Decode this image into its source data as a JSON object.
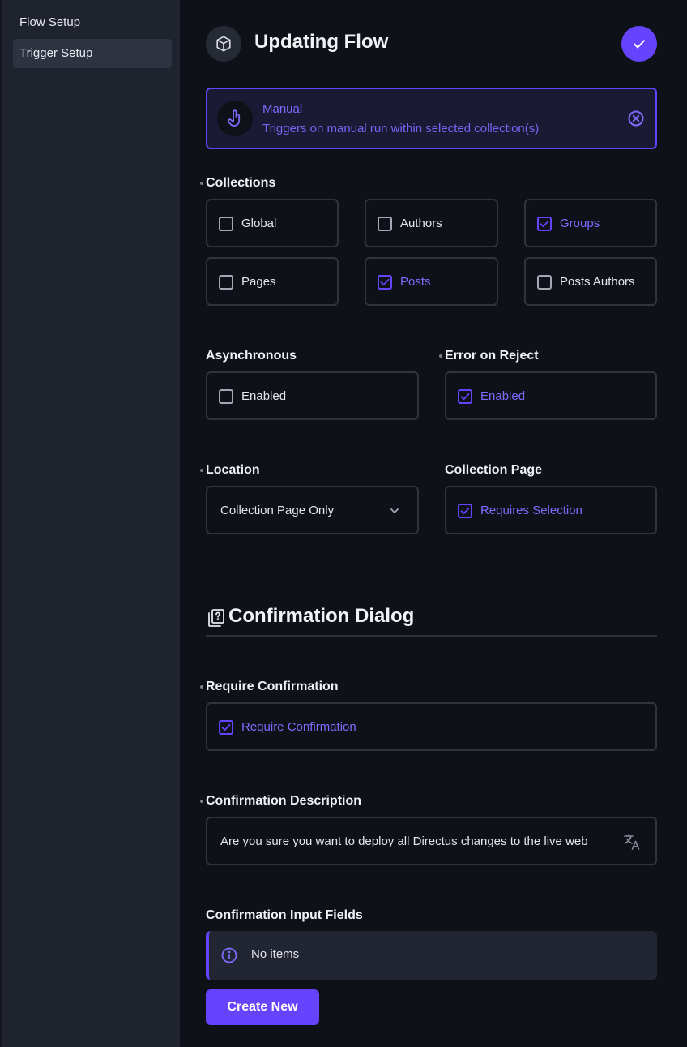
{
  "sidebar": {
    "items": [
      {
        "label": "Flow Setup"
      },
      {
        "label": "Trigger Setup"
      }
    ]
  },
  "header": {
    "title": "Updating Flow",
    "icon": "cube-icon",
    "save_icon": "check-icon"
  },
  "trigger": {
    "name": "Manual",
    "description": "Triggers on manual run within selected collection(s)",
    "icon": "touch-icon"
  },
  "collections": {
    "label": "Collections",
    "options": [
      {
        "label": "Global",
        "checked": false
      },
      {
        "label": "Authors",
        "checked": false
      },
      {
        "label": "Groups",
        "checked": true
      },
      {
        "label": "Pages",
        "checked": false
      },
      {
        "label": "Posts",
        "checked": true
      },
      {
        "label": "Posts Authors",
        "checked": false
      }
    ]
  },
  "asynchronous": {
    "label": "Asynchronous",
    "option": "Enabled",
    "checked": false
  },
  "error_on_reject": {
    "label": "Error on Reject",
    "option": "Enabled",
    "checked": true
  },
  "location": {
    "label": "Location",
    "value": "Collection Page Only"
  },
  "collection_page": {
    "label": "Collection Page",
    "option": "Requires Selection",
    "checked": true
  },
  "confirmation_section": {
    "title": "Confirmation Dialog"
  },
  "require_confirmation": {
    "label": "Require Confirmation",
    "option": "Require Confirmation",
    "checked": true
  },
  "confirmation_description": {
    "label": "Confirmation Description",
    "value": "Are you sure you want to deploy all Directus changes to the live web"
  },
  "confirmation_input_fields": {
    "label": "Confirmation Input Fields",
    "empty_text": "No items",
    "create_label": "Create New"
  },
  "colors": {
    "accent": "#6644ff",
    "background": "#0f1119",
    "sidebar": "#1f232e"
  }
}
